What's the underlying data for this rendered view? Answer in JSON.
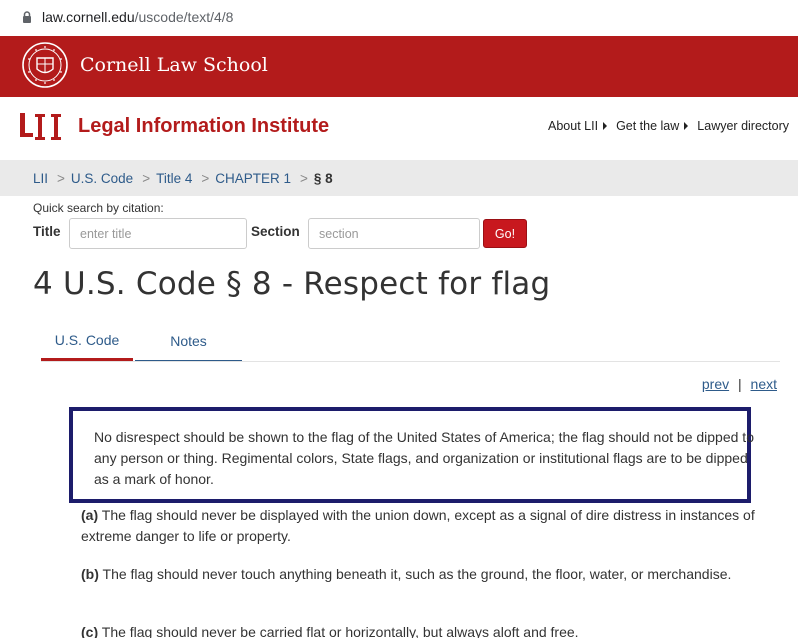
{
  "browser": {
    "url_host": "law.cornell.edu",
    "url_path": "/uscode/text/4/8"
  },
  "cornell": {
    "name": "Cornell Law School"
  },
  "lii": {
    "title": "Legal Information Institute",
    "nav": [
      {
        "label": "About LII"
      },
      {
        "label": "Get the law"
      },
      {
        "label": "Lawyer directory"
      }
    ]
  },
  "breadcrumb": {
    "items": [
      "LII",
      "U.S. Code",
      "Title 4",
      "CHAPTER 1"
    ],
    "current": "§ 8",
    "separator": ">"
  },
  "quick_search": {
    "label": "Quick search by citation:",
    "title_label": "Title",
    "title_placeholder": "enter title",
    "section_label": "Section",
    "section_placeholder": "section",
    "go_label": "Go!"
  },
  "heading": "4 U.S. Code § 8 - Respect for flag",
  "tabs": [
    {
      "label": "U.S. Code",
      "active": true
    },
    {
      "label": "Notes",
      "active": false
    }
  ],
  "pager": {
    "prev": "prev",
    "sep": "|",
    "next": "next"
  },
  "intro": "No disrespect should be shown to the flag of the United States of America; the flag should not be dipped to any person or thing. Regimental colors, State flags, and organization or institutional flags are to be dipped as a mark of honor.",
  "paragraphs": [
    {
      "marker": "(a)",
      "text": " The flag should never be displayed with the union down, except as a signal of dire distress in instances of extreme danger to life or property."
    },
    {
      "marker": "(b)",
      "text": " The flag should never touch anything beneath it, such as the ground, the floor, water, or merchandise."
    },
    {
      "marker": "(c)",
      "text": " The flag should never be carried flat or horizontally, but always aloft and free."
    }
  ],
  "colors": {
    "cornell_red": "#b31b1b",
    "link_blue": "#2e5b8a",
    "highlight_border": "#1c1c6b",
    "go_button": "#c8181e"
  }
}
